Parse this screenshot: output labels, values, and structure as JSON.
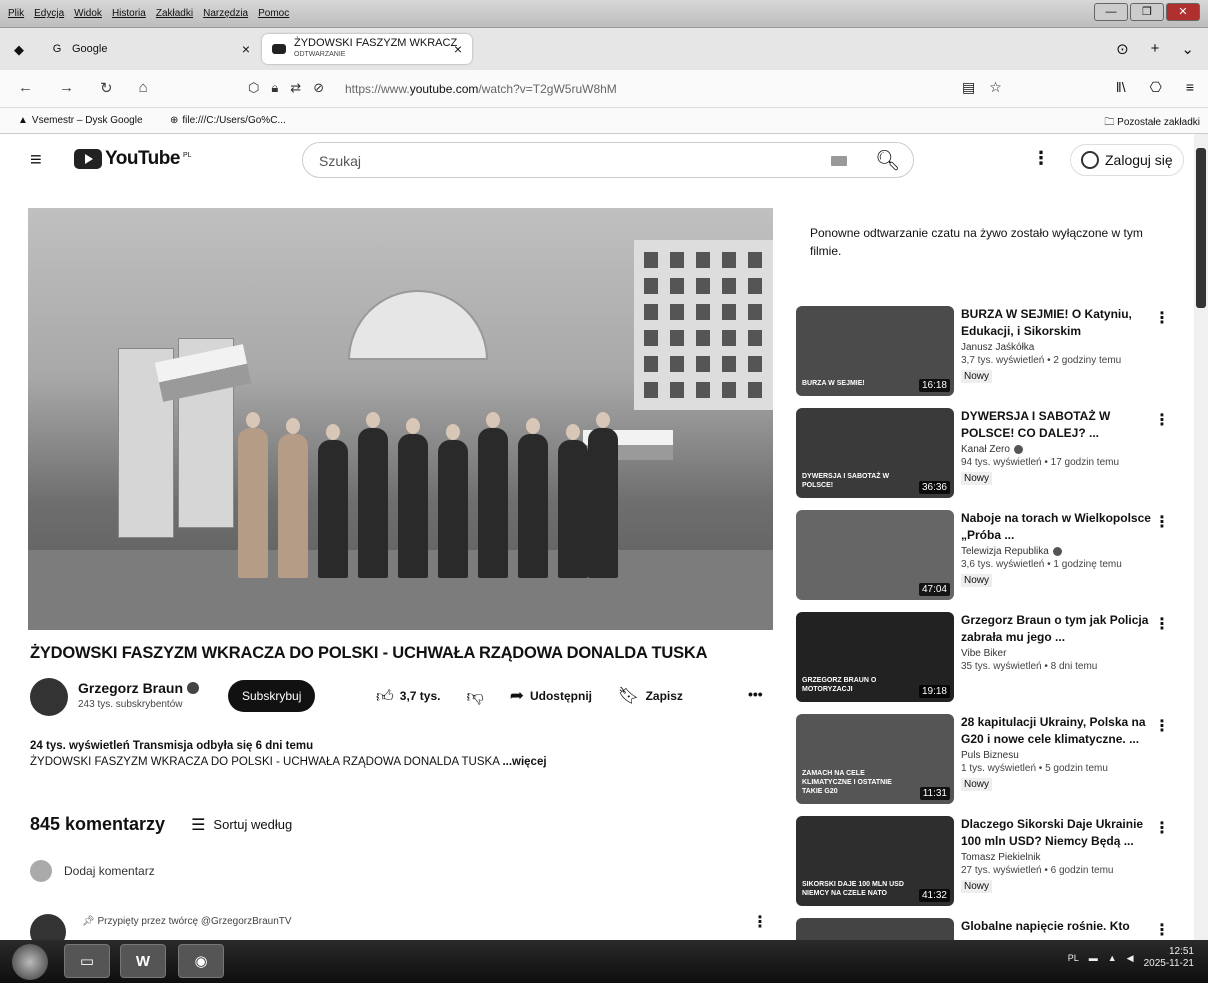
{
  "menubar": {
    "items": [
      "Plik",
      "Edycja",
      "Widok",
      "Historia",
      "Zakładki",
      "Narzędzia",
      "Pomoc"
    ]
  },
  "tabs": [
    {
      "title": "Google",
      "active": false
    },
    {
      "title": "ŻYDOWSKI FASZYZM WKRACZ",
      "subtitle": "ODTWARZANIE",
      "active": true
    }
  ],
  "nav": {
    "url_prefix": "https://www.",
    "url_domain": "youtube.com",
    "url_suffix": "/watch?v=T2gW5ruW8hM"
  },
  "bookmarks": {
    "items": [
      "Vsemestr – Dysk Google",
      "file:///C:/Users/Go%C..."
    ],
    "other": "Pozostałe zakładki"
  },
  "yt": {
    "logo": "YouTube",
    "region": "PL",
    "search_placeholder": "Szukaj",
    "signin": "Zaloguj się"
  },
  "video": {
    "title": "ŻYDOWSKI FASZYZM WKRACZA DO POLSKI - UCHWAŁA RZĄDOWA DONALDA TUSKA",
    "channel": "Grzegorz Braun",
    "subscribers": "243 tys. subskrybentów",
    "subscribe_label": "Subskrybuj",
    "likes": "3,7 tys.",
    "share_label": "Udostępnij",
    "save_label": "Zapisz",
    "more_label": "•••",
    "views_line": "24 tys. wyświetleń  Transmisja odbyła się 6 dni temu",
    "desc_line": "ŻYDOWSKI FASZYZM WKRACZA DO POLSKI - UCHWAŁA RZĄDOWA  DONALDA TUSKA ",
    "desc_more": "...więcej"
  },
  "comments": {
    "count": "845 komentarzy",
    "sort_label": "Sortuj według",
    "add_label": "Dodaj komentarz",
    "pinned_label": "Przypięty przez twórcę @GrzegorzBraunTV"
  },
  "sidebar": {
    "chat_note": "Ponowne odtwarzanie czatu na żywo zostało wyłączone w tym filmie.",
    "recs": [
      {
        "title": "BURZA W SEJMIE! O Katyniu, Edukacji, i Sikorskim",
        "channel": "Janusz Jaśkółka",
        "verified": false,
        "meta": "3,7 tys. wyświetleń • 2 godziny temu",
        "badge": "Nowy",
        "duration": "16:18",
        "overlay": "BURZA W SEJMIE!"
      },
      {
        "title": "DYWERSJA I SABOTAŻ W POLSCE! CO DALEJ? ...",
        "channel": "Kanał Zero",
        "verified": true,
        "meta": "94 tys. wyświetleń • 17 godzin temu",
        "badge": "Nowy",
        "duration": "36:36",
        "overlay": "DYWERSJA I SABOTAŻ W POLSCE!"
      },
      {
        "title": "Naboje na torach w Wielkopolsce „Próba ...",
        "channel": "Telewizja Republika",
        "verified": true,
        "meta": "3,6 tys. wyświetleń • 1 godzinę temu",
        "badge": "Nowy",
        "duration": "47:04",
        "overlay": ""
      },
      {
        "title": "Grzegorz Braun o tym jak Policja zabrała mu jego ...",
        "channel": "Vibe Biker",
        "verified": false,
        "meta": "35 tys. wyświetleń • 8 dni temu",
        "badge": "",
        "duration": "19:18",
        "overlay": "GRZEGORZ BRAUN O MOTORYZACJI"
      },
      {
        "title": "28 kapitulacji Ukrainy, Polska na G20 i nowe cele klimatyczne. ...",
        "channel": "Puls Biznesu",
        "verified": false,
        "meta": "1 tys. wyświetleń • 5 godzin temu",
        "badge": "Nowy",
        "duration": "11:31",
        "overlay": "ZAMACH NA CELE KLIMATYCZNE I OSTATNIE TAKIE G20"
      },
      {
        "title": "Dlaczego Sikorski Daje Ukrainie 100 mln USD? Niemcy Będą ...",
        "channel": "Tomasz Piekielnik",
        "verified": false,
        "meta": "27 tys. wyświetleń • 6 godzin temu",
        "badge": "Nowy",
        "duration": "41:32",
        "overlay": "SIKORSKI DAJE 100 MLN USD NIEMCY NA CZELE NATO"
      },
      {
        "title": "Globalne napięcie rośnie. Kto",
        "channel": "",
        "verified": false,
        "meta": "",
        "badge": "",
        "duration": "",
        "overlay": ""
      }
    ]
  },
  "taskbar": {
    "lang": "PL",
    "time": "12:51",
    "date": "2025-11-21",
    "word_label": "W"
  }
}
